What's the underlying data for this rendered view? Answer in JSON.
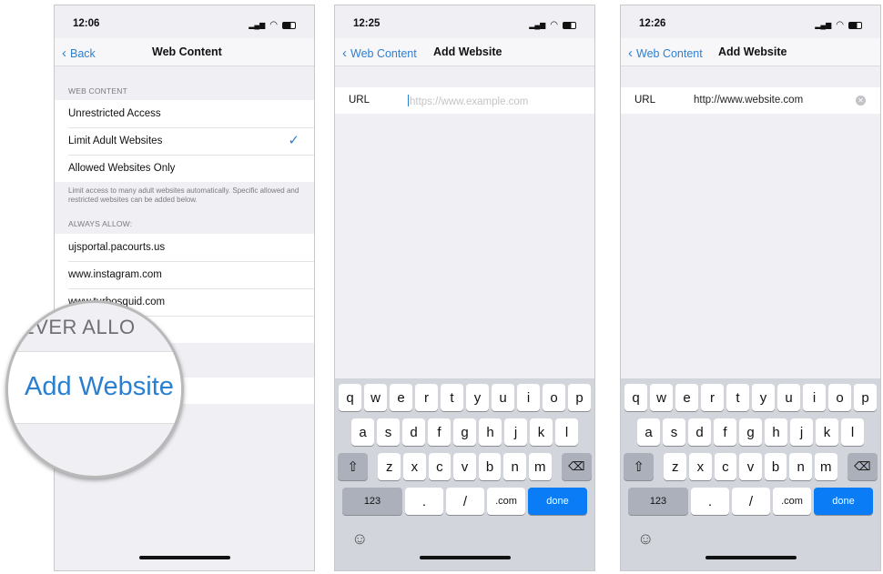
{
  "screens": [
    {
      "time": "12:06",
      "back_label": "Back",
      "title": "Web Content",
      "web_content_header": "WEB CONTENT",
      "options": [
        {
          "label": "Unrestricted Access",
          "selected": false
        },
        {
          "label": "Limit Adult Websites",
          "selected": true
        },
        {
          "label": "Allowed Websites Only",
          "selected": false
        }
      ],
      "footer": "Limit access to many adult websites automatically. Specific allowed and restricted websites can be added below.",
      "always_allow_header": "ALWAYS ALLOW:",
      "always_allow": [
        "ujsportal.pacourts.us",
        "www.instagram.com",
        "www.turbosquid.com"
      ],
      "magnifier": {
        "section_fragment": "EVER ALLO",
        "add_label": "Add Website"
      }
    },
    {
      "time": "12:25",
      "back_label": "Web Content",
      "title": "Add Website",
      "url_label": "URL",
      "url_placeholder": "https://www.example.com",
      "url_value": ""
    },
    {
      "time": "12:26",
      "back_label": "Web Content",
      "title": "Add Website",
      "url_label": "URL",
      "url_value": "http://www.website.com"
    }
  ],
  "keyboard": {
    "rows": [
      [
        "q",
        "w",
        "e",
        "r",
        "t",
        "y",
        "u",
        "i",
        "o",
        "p"
      ],
      [
        "a",
        "s",
        "d",
        "f",
        "g",
        "h",
        "j",
        "k",
        "l"
      ],
      [
        "z",
        "x",
        "c",
        "v",
        "b",
        "n",
        "m"
      ]
    ],
    "numbers_label": "123",
    "dot_label": ".",
    "slash_label": "/",
    "com_label": ".com",
    "done_label": "done"
  },
  "colors": {
    "accent": "#2f80d1",
    "done_key": "#0a7cf5"
  }
}
